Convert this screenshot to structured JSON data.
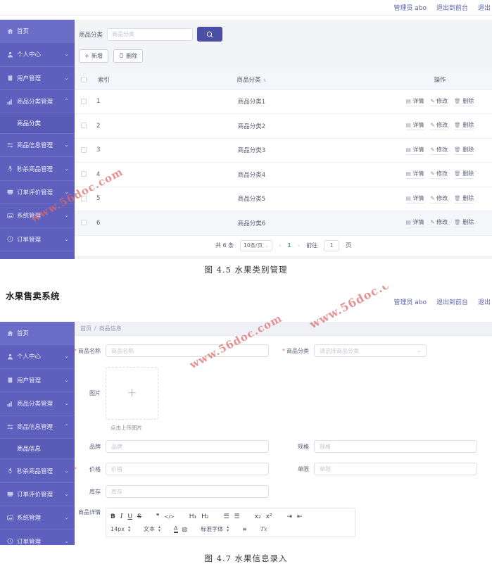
{
  "app": {
    "title": "水果售卖系统",
    "topbar_links": [
      "管理员 abo",
      "退出到前台",
      "退出"
    ]
  },
  "sidebar": {
    "items": [
      {
        "label": "首页",
        "icon": "home-icon",
        "caret": "",
        "active": true
      },
      {
        "label": "个人中心",
        "icon": "user-icon",
        "caret": "⌄"
      },
      {
        "label": "用户管理",
        "icon": "clipboard-icon",
        "caret": "⌄"
      },
      {
        "label": "商品分类管理",
        "icon": "tag-icon",
        "caret": "⌃"
      },
      {
        "label": "商品信息管理",
        "icon": "sliders-icon",
        "caret": "⌄"
      },
      {
        "label": "秒杀商品管理",
        "icon": "mic-icon",
        "caret": "⌄"
      },
      {
        "label": "订单评价管理",
        "icon": "comment-icon",
        "caret": "⌄"
      },
      {
        "label": "系统管理",
        "icon": "image-icon",
        "caret": "⌄"
      },
      {
        "label": "订单管理",
        "icon": "clock-icon",
        "caret": "⌄"
      }
    ],
    "submenu_category": "商品分类",
    "submenu_goods": "商品信息"
  },
  "shot1": {
    "search": {
      "label": "商品分类",
      "placeholder": "商品分类",
      "value": "",
      "button_icon": "search-icon"
    },
    "toolbar": {
      "add_label": "新增",
      "add_glyph": "+",
      "delete_label": "删除",
      "delete_glyph": "🗑"
    },
    "table": {
      "headers": [
        "",
        "索引",
        "商品分类",
        "操作"
      ],
      "sort_col": "商品分类",
      "rows": [
        {
          "index": "1",
          "category": "商品分类1",
          "highlight": false
        },
        {
          "index": "2",
          "category": "商品分类2",
          "highlight": false
        },
        {
          "index": "3",
          "category": "商品分类3",
          "highlight": false
        },
        {
          "index": "4",
          "category": "商品分类4",
          "highlight": false
        },
        {
          "index": "5",
          "category": "商品分类5",
          "highlight": false
        },
        {
          "index": "6",
          "category": "商品分类6",
          "highlight": true
        }
      ],
      "actions": [
        {
          "label": "详情",
          "icon": "detail-icon"
        },
        {
          "label": "修改",
          "icon": "edit-icon"
        },
        {
          "label": "删除",
          "icon": "trash-icon"
        }
      ]
    },
    "pagination": {
      "total": "共 6 条",
      "page_size": "10条/页",
      "prev": "‹",
      "current": "1",
      "next": "›",
      "goto_label": "前往",
      "goto_value": "1",
      "page_unit": "页"
    },
    "caption": "图 4.5  水果类别管理"
  },
  "shot2": {
    "breadcrumb": [
      "首页",
      "/",
      "商品信息"
    ],
    "form": {
      "name": {
        "label": "商品名称",
        "placeholder": "商品名称",
        "required": true
      },
      "category": {
        "label": "商品分类",
        "placeholder": "请选择商品分类",
        "required": true
      },
      "image": {
        "label": "图片",
        "plus": "+",
        "hint": "点击上传图片"
      },
      "brand": {
        "label": "品牌",
        "placeholder": "品牌",
        "required": false
      },
      "spec": {
        "label": "规格",
        "placeholder": "规格",
        "required": false
      },
      "price": {
        "label": "价格",
        "placeholder": "价格",
        "required": true
      },
      "limit": {
        "label": "单限",
        "placeholder": "单限",
        "required": false
      },
      "stock": {
        "label": "库存",
        "placeholder": "库存",
        "required": false
      },
      "detail": {
        "label": "商品详情"
      }
    },
    "editor": {
      "row1": [
        "B",
        "I",
        "U",
        "S",
        "❞",
        "</>",
        "H₁",
        "H₂",
        "☰",
        "☰",
        "x₂",
        "x²",
        "⇥",
        "⇤"
      ],
      "font_size": "14px",
      "text_style": "文本",
      "font_family": "标准字体",
      "color_icon": "A",
      "highlight_icon": "▨",
      "align_icon": "≡",
      "clear_icon": "Tx"
    },
    "caption": "图 4.7  水果信息录入"
  },
  "watermark": {
    "text": "www.56doc.com",
    "color": "#d96a6a"
  }
}
